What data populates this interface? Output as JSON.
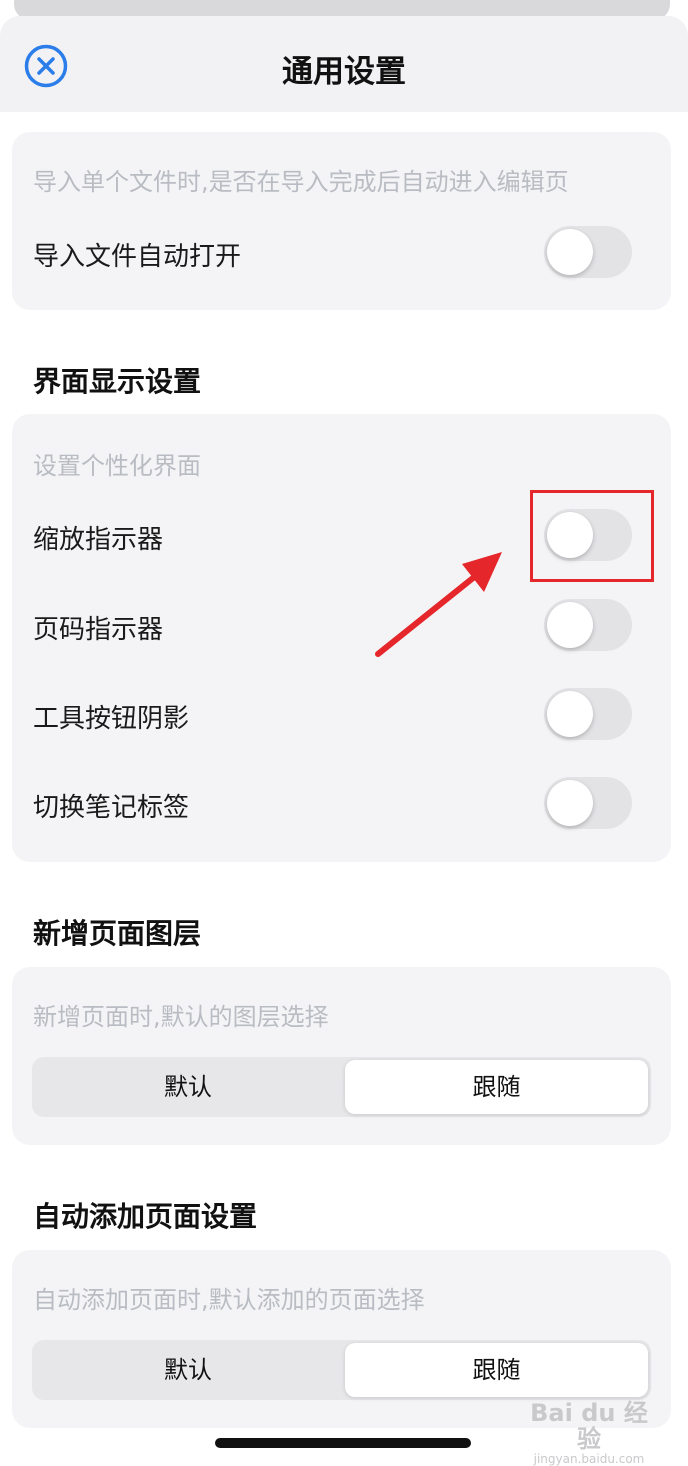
{
  "header": {
    "title": "通用设置",
    "close_icon": "close-circle-icon"
  },
  "import": {
    "description": "导入单个文件时,是否在导入完成后自动进入编辑页",
    "auto_open_label": "导入文件自动打开",
    "auto_open_on": false
  },
  "display": {
    "title": "界面显示设置",
    "description": "设置个性化界面",
    "items": [
      {
        "label": "缩放指示器",
        "on": false
      },
      {
        "label": "页码指示器",
        "on": false
      },
      {
        "label": "工具按钮阴影",
        "on": false
      },
      {
        "label": "切换笔记标签",
        "on": false
      }
    ]
  },
  "new_page_layer": {
    "title": "新增页面图层",
    "description": "新增页面时,默认的图层选择",
    "options": [
      "默认",
      "跟随"
    ],
    "selected": "跟随"
  },
  "auto_add_page": {
    "title": "自动添加页面设置",
    "description": "自动添加页面时,默认添加的页面选择",
    "options": [
      "默认",
      "跟随"
    ],
    "selected": "跟随"
  },
  "annotation": {
    "highlight_color": "#e5262a",
    "target": "缩放指示器"
  },
  "watermark": {
    "brand": "Bai du 经验",
    "url": "jingyan.baidu.com"
  },
  "colors": {
    "accent": "#2b7de9",
    "toggle_off": "#e3e3e6",
    "card_bg": "#f4f4f6"
  }
}
